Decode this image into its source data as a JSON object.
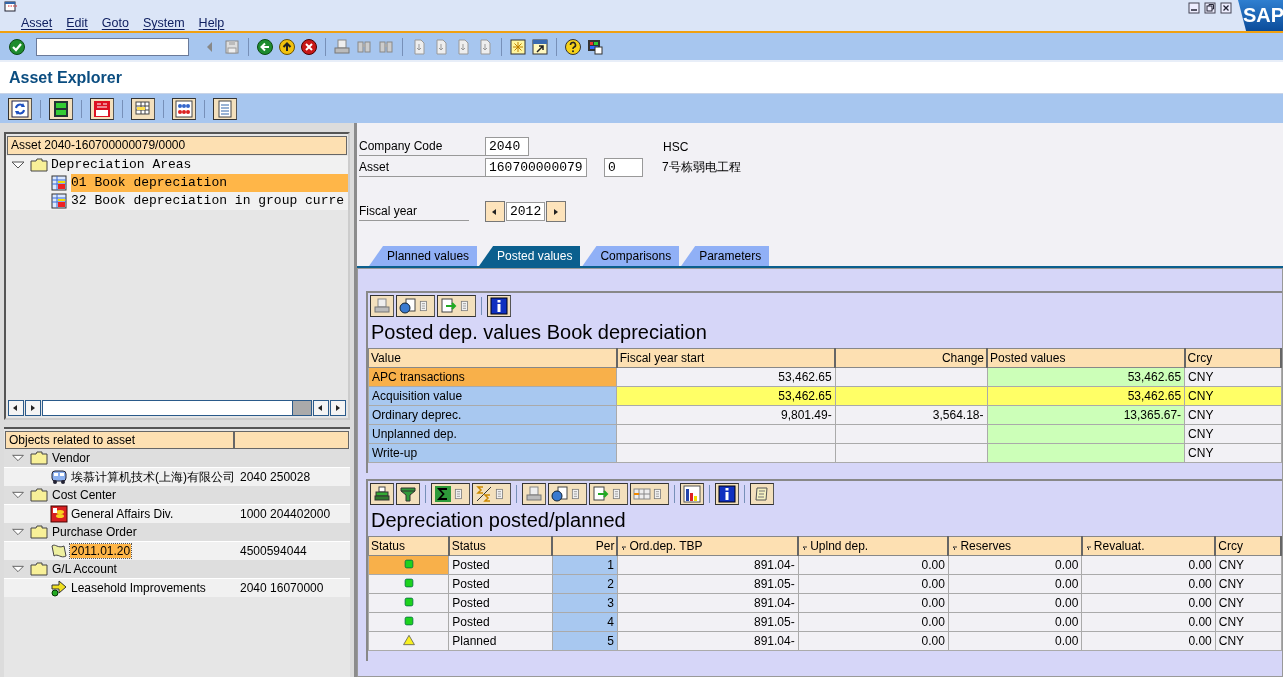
{
  "window": {
    "logo": "SAP"
  },
  "menu": [
    "Asset",
    "Edit",
    "Goto",
    "System",
    "Help"
  ],
  "title": "Asset Explorer",
  "asset_tree": {
    "header": "Asset 2040-160700000079/0000",
    "nodes": [
      {
        "label": "Depreciation Areas",
        "expanded": true,
        "children": [
          {
            "label": "01 Book depreciation",
            "selected": true
          },
          {
            "label": "32 Book depreciation in group curre",
            "selected": false
          }
        ]
      }
    ]
  },
  "related_objects": {
    "column_1": "Objects related to asset",
    "groups": [
      {
        "label": "Vendor",
        "expanded": true,
        "children": [
          {
            "kind": "vendor",
            "label": "埃慕计算机技术(上海)有限公司",
            "value": "2040 250028",
            "selected": false
          }
        ]
      },
      {
        "label": "Cost Center",
        "expanded": true,
        "children": [
          {
            "kind": "cost_center",
            "label": "General Affairs Div.",
            "value": "1000 204402000",
            "selected": false
          }
        ]
      },
      {
        "label": "Purchase Order",
        "expanded": true,
        "children": [
          {
            "kind": "purchase_order",
            "label": "2011.01.20",
            "value": "4500594044",
            "selected": true
          }
        ]
      },
      {
        "label": "G/L Account",
        "expanded": true,
        "children": [
          {
            "kind": "gl_account",
            "label": "Leasehold Improvements",
            "value": "2040 16070000",
            "selected": false
          }
        ]
      }
    ]
  },
  "header_fields": {
    "company_code": {
      "label": "Company Code",
      "value": "2040",
      "description": "HSC"
    },
    "asset": {
      "label": "Asset",
      "value": "160700000079",
      "subnumber": "0",
      "description": "7号栋弱电工程"
    },
    "fiscal_year": {
      "label": "Fiscal year",
      "value": "2012"
    }
  },
  "tabs": [
    {
      "label": "Planned values",
      "selected": false
    },
    {
      "label": "Posted values",
      "selected": true
    },
    {
      "label": "Comparisons",
      "selected": false
    },
    {
      "label": "Parameters",
      "selected": false
    }
  ],
  "posted_values_grid": {
    "title": "Posted dep. values Book depreciation",
    "columns": [
      "Value",
      "Fiscal year start",
      "Change",
      "Posted values",
      "Crcy"
    ],
    "rows": [
      {
        "value": "APC transactions",
        "fiscal_year_start": "53,462.65",
        "posted_values": "53,462.65",
        "crcy": "CNY",
        "selected": true,
        "highlighted": false
      },
      {
        "value": "Acquisition value",
        "fiscal_year_start": "53,462.65",
        "posted_values": "53,462.65",
        "crcy": "CNY",
        "selected": false,
        "highlighted": true
      },
      {
        "value": "Ordinary deprec.",
        "fiscal_year_start": "9,801.49-",
        "change": "3,564.18-",
        "posted_values": "13,365.67-",
        "crcy": "CNY",
        "selected": false,
        "highlighted": false
      },
      {
        "value": "Unplanned dep.",
        "crcy": "CNY",
        "selected": false,
        "highlighted": false
      },
      {
        "value": "Write-up",
        "crcy": "CNY",
        "selected": false,
        "highlighted": false
      }
    ]
  },
  "depreciation_grid": {
    "title": "Depreciation posted/planned",
    "columns": [
      {
        "label": "Status",
        "summed": false
      },
      {
        "label": "Status",
        "summed": false
      },
      {
        "label": "Per",
        "summed": false
      },
      {
        "label": "Ord.dep. TBP",
        "summed": true
      },
      {
        "label": "Uplnd dep.",
        "summed": true
      },
      {
        "label": "Reserves",
        "summed": true
      },
      {
        "label": "Revaluat.",
        "summed": true
      },
      {
        "label": "Crcy",
        "summed": false
      }
    ],
    "rows": [
      {
        "kind": "posted",
        "status_text": "Posted",
        "per": "1",
        "ord_dep_tbp": "891.04-",
        "uplnd_dep": "0.00",
        "reserves": "0.00",
        "revaluat": "0.00",
        "crcy": "CNY",
        "selected": true
      },
      {
        "kind": "posted",
        "status_text": "Posted",
        "per": "2",
        "ord_dep_tbp": "891.05-",
        "uplnd_dep": "0.00",
        "reserves": "0.00",
        "revaluat": "0.00",
        "crcy": "CNY",
        "selected": false
      },
      {
        "kind": "posted",
        "status_text": "Posted",
        "per": "3",
        "ord_dep_tbp": "891.04-",
        "uplnd_dep": "0.00",
        "reserves": "0.00",
        "revaluat": "0.00",
        "crcy": "CNY",
        "selected": false
      },
      {
        "kind": "posted",
        "status_text": "Posted",
        "per": "4",
        "ord_dep_tbp": "891.05-",
        "uplnd_dep": "0.00",
        "reserves": "0.00",
        "revaluat": "0.00",
        "crcy": "CNY",
        "selected": false
      },
      {
        "kind": "planned",
        "status_text": "Planned",
        "per": "5",
        "ord_dep_tbp": "891.04-",
        "uplnd_dep": "0.00",
        "reserves": "0.00",
        "revaluat": "0.00",
        "crcy": "CNY",
        "selected": false
      }
    ]
  }
}
